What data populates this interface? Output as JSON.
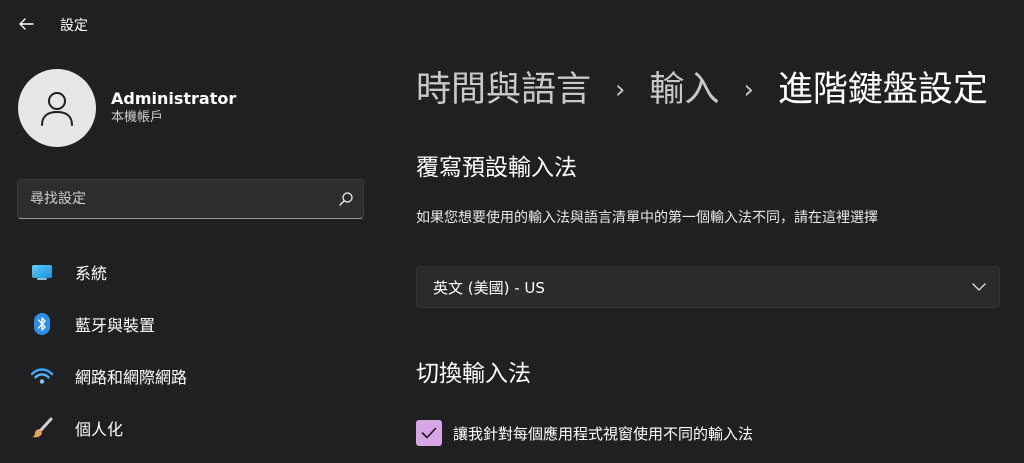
{
  "app": {
    "title": "設定"
  },
  "profile": {
    "name": "Administrator",
    "account_type": "本機帳戶"
  },
  "search": {
    "placeholder": "尋找設定"
  },
  "sidebar": {
    "items": [
      {
        "label": "系統",
        "icon": "monitor-icon"
      },
      {
        "label": "藍牙與裝置",
        "icon": "bluetooth-icon"
      },
      {
        "label": "網路和網際網路",
        "icon": "wifi-icon"
      },
      {
        "label": "個人化",
        "icon": "brush-icon"
      }
    ]
  },
  "breadcrumb": {
    "items": [
      "時間與語言",
      "輸入"
    ],
    "separator": "›",
    "current": "進階鍵盤設定"
  },
  "override": {
    "title": "覆寫預設輸入法",
    "description": "如果您想要使用的輸入法與語言清單中的第一個輸入法不同，請在這裡選擇",
    "selected_value": "英文 (美國) - US"
  },
  "switching": {
    "title": "切換輸入法",
    "checkbox_label": "讓我針對每個應用程式視窗使用不同的輸入法",
    "checkbox_checked": true
  },
  "colors": {
    "background": "#202020",
    "accent": "#d8a6e6"
  }
}
